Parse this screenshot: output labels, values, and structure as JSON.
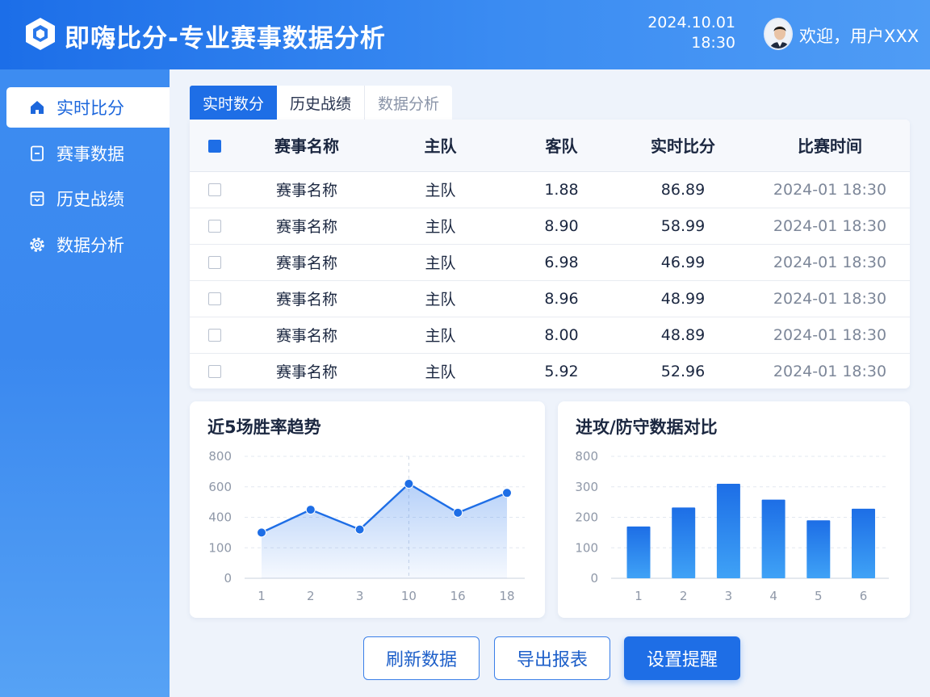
{
  "header": {
    "title": "即嗨比分-专业赛事数据分析",
    "date": "2024.10.01",
    "time": "18:30",
    "welcome": "欢迎，用户XXX"
  },
  "sidebar": {
    "items": [
      {
        "label": "实时比分",
        "icon": "home-icon",
        "active": true
      },
      {
        "label": "赛事数据",
        "icon": "document-icon",
        "active": false
      },
      {
        "label": "历史战绩",
        "icon": "archive-icon",
        "active": false
      },
      {
        "label": "数据分析",
        "icon": "gear-icon",
        "active": false
      }
    ]
  },
  "tabs": [
    {
      "label": "实时数分",
      "active": true
    },
    {
      "label": "历史战绩",
      "active": false
    },
    {
      "label": "数据分析",
      "active": false
    }
  ],
  "table": {
    "columns": [
      "赛事名称",
      "主队",
      "客队",
      "实时比分",
      "比赛时间"
    ],
    "rows": [
      {
        "name": "赛事名称",
        "home": "主队",
        "away": "1.88",
        "score": "86.89",
        "time": "2024-01 18:30"
      },
      {
        "name": "赛事名称",
        "home": "主队",
        "away": "8.90",
        "score": "58.99",
        "time": "2024-01 18:30"
      },
      {
        "name": "赛事名称",
        "home": "主队",
        "away": "6.98",
        "score": "46.99",
        "time": "2024-01 18:30"
      },
      {
        "name": "赛事名称",
        "home": "主队",
        "away": "8.96",
        "score": "48.99",
        "time": "2024-01 18:30"
      },
      {
        "name": "赛事名称",
        "home": "主队",
        "away": "8.00",
        "score": "48.89",
        "time": "2024-01 18:30"
      },
      {
        "name": "赛事名称",
        "home": "主队",
        "away": "5.92",
        "score": "52.96",
        "time": "2024-01 18:30"
      }
    ]
  },
  "chart_data": [
    {
      "type": "area",
      "title": "近5场胜率趋势",
      "categories": [
        "1",
        "2",
        "3",
        "10",
        "16",
        "18"
      ],
      "y_ticks": [
        "0",
        "100",
        "400",
        "600",
        "800"
      ],
      "series": [
        {
          "values": [
            250,
            450,
            280,
            620,
            430,
            560
          ]
        }
      ],
      "grid": true,
      "color": "#1e6ee6"
    },
    {
      "type": "bar",
      "title": "进攻/防守数据对比",
      "categories": [
        "1",
        "2",
        "3",
        "4",
        "5",
        "6"
      ],
      "y_ticks": [
        "0",
        "100",
        "200",
        "300",
        "800"
      ],
      "series": [
        {
          "values": [
            170,
            232,
            350,
            258,
            190,
            228
          ]
        }
      ],
      "grid": true,
      "color": "#1e6ee6"
    }
  ],
  "buttons": {
    "refresh": "刷新数据",
    "export": "导出报表",
    "reminder": "设置提醒"
  }
}
